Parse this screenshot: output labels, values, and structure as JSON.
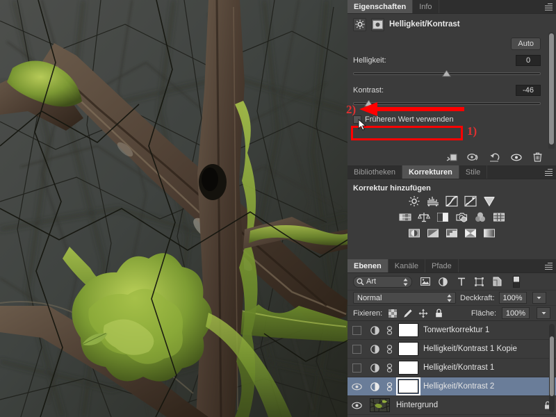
{
  "properties_panel": {
    "tabs": [
      {
        "label": "Eigenschaften",
        "active": true
      },
      {
        "label": "Info",
        "active": false
      }
    ],
    "adjustment_title": "Helligkeit/Kontrast",
    "auto_button": "Auto",
    "sliders": [
      {
        "label": "Helligkeit:",
        "value": "0",
        "percent": 50
      },
      {
        "label": "Kontrast:",
        "value": "-46",
        "percent": 8
      }
    ],
    "checkbox": {
      "label": "Früheren Wert verwenden",
      "checked": false
    },
    "footer_icons": [
      "clip-to-layer-icon",
      "preview-eye-toggle-icon",
      "reset-icon",
      "visibility-eye-icon",
      "delete-trash-icon"
    ]
  },
  "adjustments_panel": {
    "tabs": [
      {
        "label": "Bibliotheken",
        "active": false
      },
      {
        "label": "Korrekturen",
        "active": true
      },
      {
        "label": "Stile",
        "active": false
      }
    ],
    "title": "Korrektur hinzufügen",
    "rows": [
      [
        "brightness-contrast-icon",
        "levels-icon",
        "curves-icon",
        "exposure-icon",
        "vibrance-icon"
      ],
      [
        "hue-saturation-icon",
        "color-balance-icon",
        "black-white-icon",
        "photo-filter-icon",
        "channel-mixer-icon",
        "color-lookup-icon"
      ],
      [
        "invert-icon",
        "posterize-icon",
        "threshold-icon",
        "selective-color-icon",
        "gradient-map-icon"
      ]
    ]
  },
  "layers_panel": {
    "tabs": [
      {
        "label": "Ebenen",
        "active": true
      },
      {
        "label": "Kanäle",
        "active": false
      },
      {
        "label": "Pfade",
        "active": false
      }
    ],
    "filter": {
      "value": "Art",
      "icons": [
        "pixel-layer-filter-icon",
        "adjustment-layer-filter-icon",
        "type-layer-filter-icon",
        "shape-layer-filter-icon",
        "smart-object-filter-icon"
      ]
    },
    "blend_mode": "Normal",
    "opacity_label": "Deckkraft:",
    "opacity_value": "100%",
    "lock_label": "Fixieren:",
    "fill_label": "Fläche:",
    "fill_value": "100%",
    "lock_icons": [
      "lock-transparency-icon",
      "lock-paint-icon",
      "lock-position-icon",
      "lock-all-icon"
    ],
    "layers": [
      {
        "name": "Tonwertkorrektur 1",
        "visible": false,
        "selected": false,
        "type": "adjustment",
        "locked": false
      },
      {
        "name": "Helligkeit/Kontrast 1 Kopie",
        "visible": false,
        "selected": false,
        "type": "adjustment",
        "locked": false
      },
      {
        "name": "Helligkeit/Kontrast 1",
        "visible": false,
        "selected": false,
        "type": "adjustment",
        "locked": false
      },
      {
        "name": "Helligkeit/Kontrast 2",
        "visible": true,
        "selected": true,
        "type": "adjustment",
        "locked": false
      },
      {
        "name": "Hintergrund",
        "visible": true,
        "selected": false,
        "type": "background",
        "locked": true
      }
    ]
  },
  "annotations": {
    "marker_1": "1)",
    "marker_2": "2)",
    "color": "#ff0000"
  },
  "canvas": {
    "description": "Mossy forest branches photograph"
  }
}
